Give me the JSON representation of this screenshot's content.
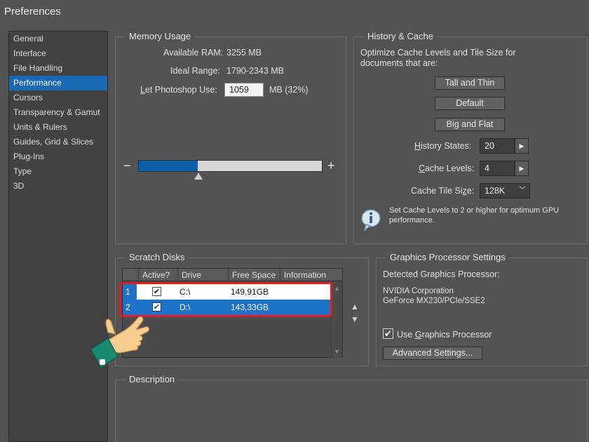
{
  "window": {
    "title": "Preferences"
  },
  "sidebar": {
    "items": [
      {
        "label": "General"
      },
      {
        "label": "Interface"
      },
      {
        "label": "File Handling"
      },
      {
        "label": "Performance"
      },
      {
        "label": "Cursors"
      },
      {
        "label": "Transparency & Gamut"
      },
      {
        "label": "Units & Rulers"
      },
      {
        "label": "Guides, Grid & Slices"
      },
      {
        "label": "Plug-Ins"
      },
      {
        "label": "Type"
      },
      {
        "label": "3D"
      }
    ],
    "selected": "Performance"
  },
  "memory": {
    "legend": "Memory Usage",
    "available_label": "Available RAM:",
    "available_value": "3255 MB",
    "ideal_label": "Ideal Range:",
    "ideal_value": "1790-2343 MB",
    "let_label_prefix": "L",
    "let_label_rest": "et Photoshop Use:",
    "let_value": "1059",
    "let_unit": "MB (32%)",
    "minus": "−",
    "plus": "+",
    "slider_fraction": 0.32
  },
  "history": {
    "legend": "History & Cache",
    "description": "Optimize Cache Levels and Tile Size for",
    "description2": "documents that are:",
    "btn_tall": "Tall and Thin",
    "btn_default": "Default",
    "btn_big": "Big and Flat",
    "states_label_prefix": "H",
    "states_label_rest": "istory States:",
    "states_value": "20",
    "levels_label_prefix": "C",
    "levels_label_rest": "ache Levels:",
    "levels_value": "4",
    "tile_label_a": "Cache Tile Si",
    "tile_label_u": "z",
    "tile_label_b": "e:",
    "tile_value": "128K",
    "tip_line1": "Set Cache Levels to 2 or higher for optimum GPU",
    "tip_line2": "performance.",
    "arrow": "▶",
    "dropdown_arrow": "﹀"
  },
  "scratch": {
    "legend": "Scratch Disks",
    "columns": [
      "Active?",
      "Drive",
      "Free Space",
      "Information"
    ],
    "rows": [
      {
        "num": "1",
        "active": "✔",
        "drive": "C:\\",
        "free": "149,91GB"
      },
      {
        "num": "2",
        "active": "✔",
        "drive": "D:\\",
        "free": "143,33GB"
      }
    ],
    "up": "▲",
    "down": "▼"
  },
  "gpu": {
    "legend": "Graphics Processor Settings",
    "detected_label": "Detected Graphics Processor:",
    "name1": "NVIDIA Corporation",
    "name2": "GeForce MX230/PCIe/SSE2",
    "use_a": "Use ",
    "use_u": "G",
    "use_b": "raphics Processor",
    "use_checked": "✔",
    "advanced_button": "Advanced Settings..."
  },
  "description": {
    "legend": "Description"
  },
  "colors": {
    "accent": "#1968b3",
    "highlight": "#e21c1c",
    "panel": "#535353"
  }
}
